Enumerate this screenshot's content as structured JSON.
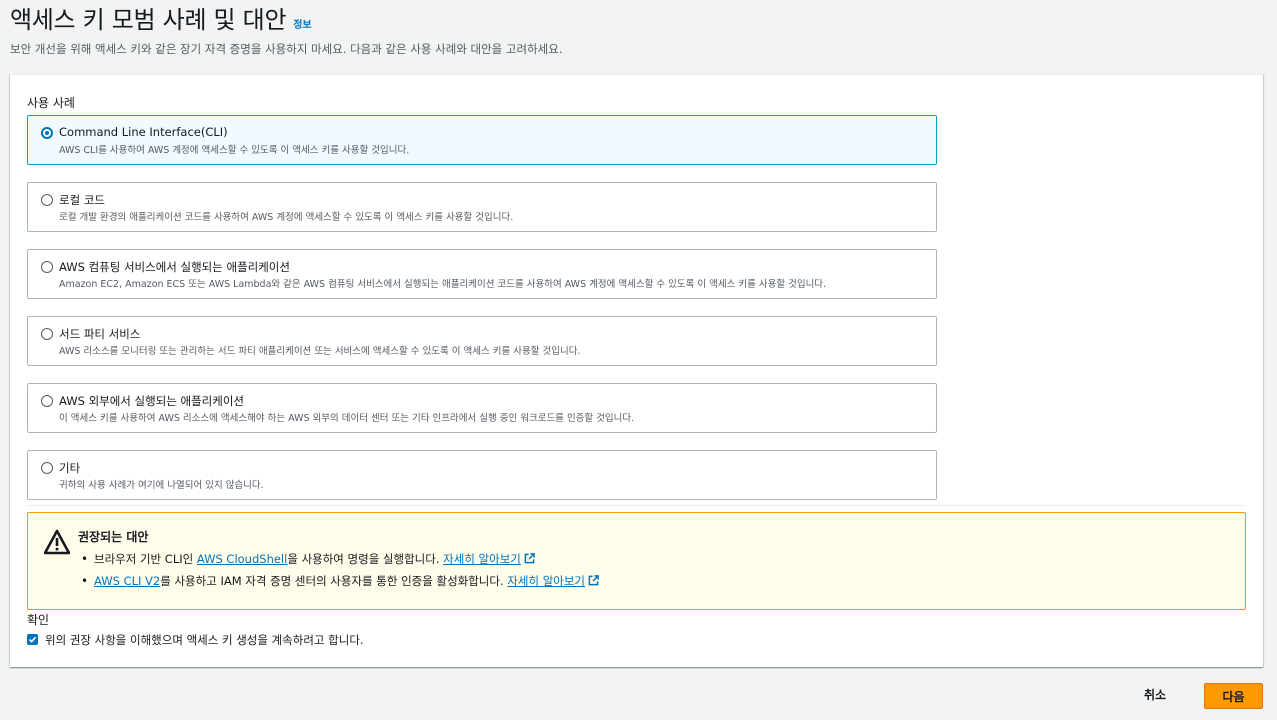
{
  "header": {
    "title": "액세스 키 모범 사례 및 대안",
    "info_link": "정보",
    "description": "보안 개선을 위해 액세스 키와 같은 장기 자격 증명을 사용하지 마세요. 다음과 같은 사용 사례와 대안을 고려하세요."
  },
  "use_case": {
    "label": "사용 사례",
    "options": [
      {
        "title": "Command Line Interface(CLI)",
        "desc": "AWS CLI를 사용하여 AWS 계정에 액세스할 수 있도록 이 액세스 키를 사용할 것입니다.",
        "selected": true
      },
      {
        "title": "로컬 코드",
        "desc": "로컬 개발 환경의 애플리케이션 코드를 사용하여 AWS 계정에 액세스할 수 있도록 이 액세스 키를 사용할 것입니다.",
        "selected": false
      },
      {
        "title": "AWS 컴퓨팅 서비스에서 실행되는 애플리케이션",
        "desc": "Amazon EC2, Amazon ECS 또는 AWS Lambda와 같은 AWS 컴퓨팅 서비스에서 실행되는 애플리케이션 코드를 사용하여 AWS 계정에 액세스할 수 있도록 이 액세스 키를 사용할 것입니다.",
        "selected": false
      },
      {
        "title": "서드 파티 서비스",
        "desc": "AWS 리소스를 모니터링 또는 관리하는 서드 파티 애플리케이션 또는 서비스에 액세스할 수 있도록 이 액세스 키를 사용할 것입니다.",
        "selected": false
      },
      {
        "title": "AWS 외부에서 실행되는 애플리케이션",
        "desc": "이 액세스 키를 사용하여 AWS 리소스에 액세스해야 하는 AWS 외부의 데이터 센터 또는 기타 인프라에서 실행 중인 워크로드를 인증할 것입니다.",
        "selected": false
      },
      {
        "title": "기타",
        "desc": "귀하의 사용 사례가 여기에 나열되어 있지 않습니다.",
        "selected": false
      }
    ]
  },
  "alert": {
    "title": "권장되는 대안",
    "item1": {
      "prefix": "브라우저 기반 CLI인 ",
      "link": "AWS CloudShell",
      "suffix": "을 사용하여 명령을 실행합니다. ",
      "learn_more": "자세히 알아보기"
    },
    "item2": {
      "link": "AWS CLI V2",
      "suffix": "를 사용하고 IAM 자격 증명 센터의 사용자를 통한 인증을 활성화합니다. ",
      "learn_more": "자세히 알아보기"
    },
    "icon": "warning-icon",
    "border_color": "#ff9900"
  },
  "confirm": {
    "label": "확인",
    "checkbox_label": "위의 권장 사항을 이해했으며 액세스 키 생성을 계속하려고 합니다.",
    "checked": true
  },
  "footer": {
    "cancel_label": "취소",
    "next_label": "다음"
  },
  "colors": {
    "accent": "#0073bb",
    "primary_button": "#ff9900",
    "selected_border": "#00a1c9"
  }
}
